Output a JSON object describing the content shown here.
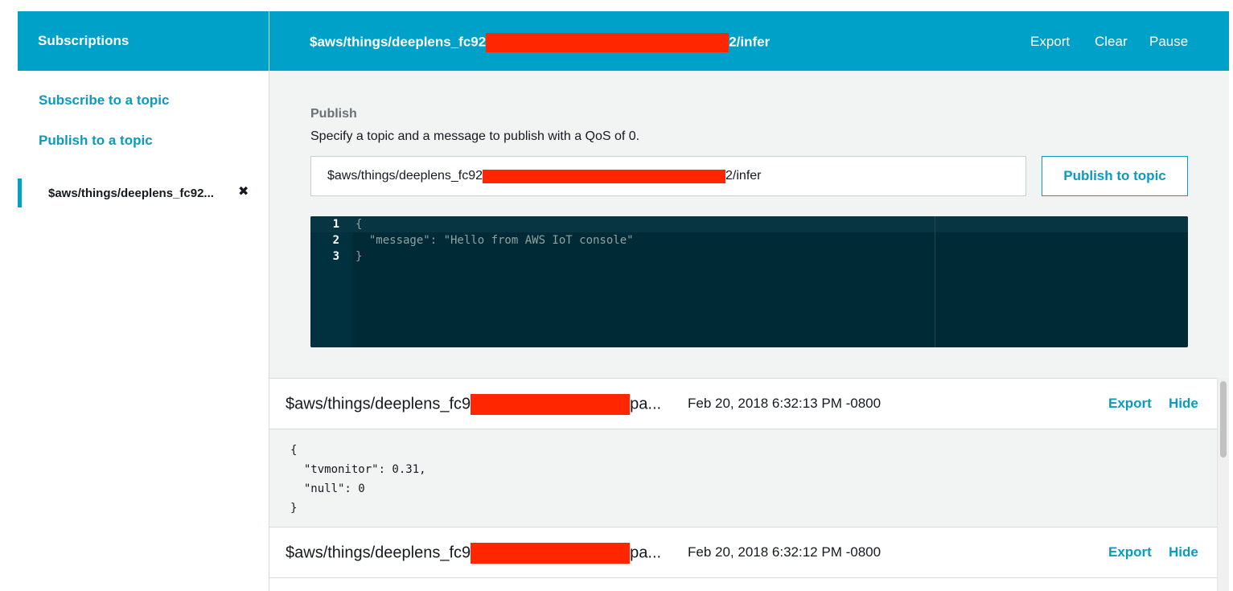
{
  "sidebar": {
    "header": "Subscriptions",
    "links": [
      {
        "label": "Subscribe to a topic"
      },
      {
        "label": "Publish to a topic"
      }
    ],
    "subscription": {
      "label": "$aws/things/deeplens_fc92...",
      "close_icon": "close-icon"
    }
  },
  "header": {
    "topic_prefix": "$aws/things/deeplens_fc92",
    "topic_suffix": "2/infer",
    "export_label": "Export",
    "clear_label": "Clear",
    "pause_label": "Pause"
  },
  "publish": {
    "title": "Publish",
    "description": "Specify a topic and a message to publish with a QoS of 0.",
    "topic_prefix": "$aws/things/deeplens_fc92",
    "topic_suffix": "2/infer",
    "button_label": "Publish to topic",
    "editor": {
      "line_numbers": [
        "1",
        "2",
        "3"
      ],
      "lines": [
        "{",
        "  \"message\": \"Hello from AWS IoT console\"",
        "}"
      ]
    }
  },
  "messages": [
    {
      "topic_prefix": "$aws/things/deeplens_fc9",
      "topic_suffix": "pa...",
      "timestamp": "Feb 20, 2018 6:32:13 PM -0800",
      "export_label": "Export",
      "hide_label": "Hide",
      "body": "{\n  \"tvmonitor\": 0.31,\n  \"null\": 0\n}"
    },
    {
      "topic_prefix": "$aws/things/deeplens_fc9",
      "topic_suffix": "pa...",
      "timestamp": "Feb 20, 2018 6:32:12 PM -0800",
      "export_label": "Export",
      "hide_label": "Hide"
    }
  ],
  "colors": {
    "header_bg": "#00a1c9",
    "link": "#0a9ac2",
    "redaction": "#ff2600",
    "editor_bg": "#002b36"
  }
}
